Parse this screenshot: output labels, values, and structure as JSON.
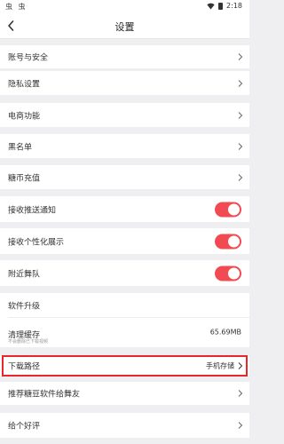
{
  "status_bar": {
    "left_icons": "虫 虫",
    "time": "2:18"
  },
  "header": {
    "title": "设置"
  },
  "sections": {
    "account_security": "账号与安全",
    "privacy": "隐私设置",
    "ecommerce": "电商功能",
    "blacklist": "黑名单",
    "recharge": "糖币充值",
    "push_notify": "接收推送通知",
    "personalized": "接收个性化展示",
    "nearby_teams": "附近舞队",
    "upgrade": "软件升级",
    "clear_cache": "清理缓存",
    "clear_cache_sub": "不会删除已下载视频",
    "cache_size": "65.69MB",
    "download_path": "下载路径",
    "download_path_value": "手机存储",
    "recommend": "推荐糖豆软件给舞友",
    "rate": "给个好评"
  },
  "toggles": {
    "push_notify": true,
    "personalized": true,
    "nearby_teams": true
  },
  "colors": {
    "accent": "#f24a52",
    "highlight_border": "#e8262b",
    "background": "#efeff1"
  },
  "icons": [
    "back-arrow-icon",
    "wifi-icon",
    "battery-icon",
    "chevron-right-icon"
  ]
}
